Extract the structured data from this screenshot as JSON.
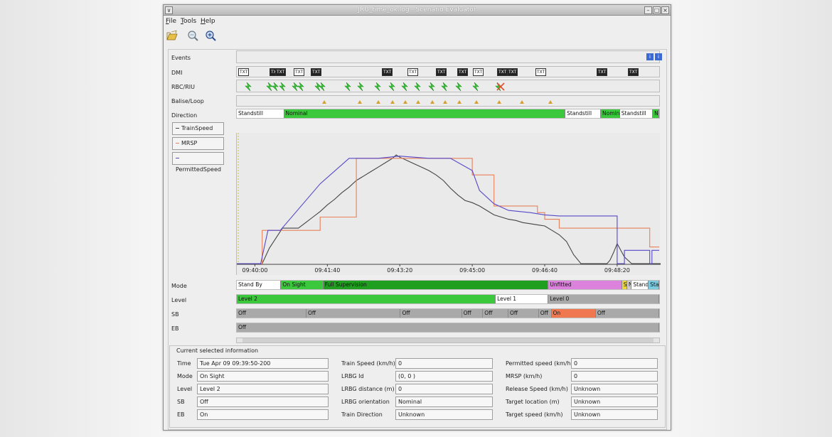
{
  "window": {
    "title": "JRU_time_ok.log - Scenario Evaluator",
    "controls": [
      "∨",
      "–",
      "□",
      "×"
    ]
  },
  "menu": [
    {
      "underline": "F",
      "rest": "ile"
    },
    {
      "underline": "T",
      "rest": "ools"
    },
    {
      "underline": "H",
      "rest": "elp"
    }
  ],
  "toolbar": {
    "icons": [
      "open-folder-icon",
      "zoom-out-icon",
      "zoom-in-icon"
    ]
  },
  "rows": {
    "events": "Events",
    "dmi": "DMI",
    "rbc": "RBC/RIU",
    "balise": "Balise/Loop",
    "direction": "Direction",
    "mode": "Mode",
    "level": "Level",
    "sb": "SB",
    "eb": "EB"
  },
  "legend": [
    {
      "label": "TrainSpeed",
      "color": "#444444"
    },
    {
      "label": "MRSP",
      "color": "#e8805a"
    },
    {
      "label": "PermittedSpeed",
      "color": "#5548c8"
    }
  ],
  "info_icons": [
    "i",
    "i"
  ],
  "dmi_labels": [
    "TXT",
    "TXT",
    "TXT",
    "TXT",
    "TXT",
    "TXT",
    "TXT",
    "TXT",
    "TXT",
    "TXT",
    "TXT",
    "TXT",
    "TXT",
    "TXT",
    "TXT"
  ],
  "direction": [
    {
      "label": "Standstill",
      "start": 0,
      "end": 0.112,
      "color": "#ffffff"
    },
    {
      "label": "Nominal",
      "start": 0.112,
      "end": 0.778,
      "color": "#3cc83c"
    },
    {
      "label": "Standstill",
      "start": 0.778,
      "end": 0.862,
      "color": "#ffffff"
    },
    {
      "label": "Nomin",
      "start": 0.862,
      "end": 0.907,
      "color": "#3cc83c"
    },
    {
      "label": "Standstill",
      "start": 0.907,
      "end": 0.985,
      "color": "#ffffff"
    },
    {
      "label": "N",
      "start": 0.985,
      "end": 1.0,
      "color": "#3cc83c"
    }
  ],
  "mode": [
    {
      "label": "Stand By",
      "start": 0,
      "end": 0.105,
      "color": "#ffffff"
    },
    {
      "label": "On Sight",
      "start": 0.105,
      "end": 0.205,
      "color": "#3cc83c"
    },
    {
      "label": "Full Supervision",
      "start": 0.205,
      "end": 0.738,
      "color": "#1f9e1f"
    },
    {
      "label": "Unfitted",
      "start": 0.738,
      "end": 0.912,
      "color": "#dc82dc"
    },
    {
      "label": "S",
      "start": 0.912,
      "end": 0.924,
      "color": "#ecd640"
    },
    {
      "label": "N",
      "start": 0.924,
      "end": 0.935,
      "color": "#cccccc"
    },
    {
      "label": "Stand",
      "start": 0.935,
      "end": 0.975,
      "color": "#ffffff"
    },
    {
      "label": "Sta",
      "start": 0.975,
      "end": 1.0,
      "color": "#7ccbe0"
    }
  ],
  "level": [
    {
      "label": "Level 2",
      "start": 0,
      "end": 0.613,
      "color": "#3cc83c"
    },
    {
      "label": "Level 1",
      "start": 0.613,
      "end": 0.738,
      "color": "#ffffff"
    },
    {
      "label": "Level 0",
      "start": 0.738,
      "end": 1.0,
      "color": "#a9a9a9"
    }
  ],
  "sb": [
    {
      "label": "Off",
      "start": 0,
      "end": 0.165,
      "color": "#a9a9a9"
    },
    {
      "label": "Off",
      "start": 0.165,
      "end": 0.388,
      "color": "#a9a9a9"
    },
    {
      "label": "Off",
      "start": 0.388,
      "end": 0.533,
      "color": "#a9a9a9"
    },
    {
      "label": "Off",
      "start": 0.533,
      "end": 0.583,
      "color": "#a9a9a9"
    },
    {
      "label": "Off",
      "start": 0.583,
      "end": 0.643,
      "color": "#a9a9a9"
    },
    {
      "label": "Off",
      "start": 0.643,
      "end": 0.715,
      "color": "#a9a9a9"
    },
    {
      "label": "Off",
      "start": 0.715,
      "end": 0.745,
      "color": "#a9a9a9"
    },
    {
      "label": "On",
      "start": 0.745,
      "end": 0.85,
      "color": "#f07850"
    },
    {
      "label": "Off",
      "start": 0.85,
      "end": 1.0,
      "color": "#a9a9a9"
    }
  ],
  "eb": [
    {
      "label": "Off",
      "start": 0,
      "end": 1.0,
      "color": "#a9a9a9"
    }
  ],
  "chart_data": {
    "type": "line",
    "title": "",
    "xlabel": "",
    "ylabel": "",
    "x_ticks": [
      "09:40:00",
      "09:41:40",
      "09:43:20",
      "09:45:00",
      "09:46:40",
      "09:48:20"
    ],
    "x_tick_seconds": [
      0,
      100,
      200,
      300,
      400,
      500
    ],
    "xlim": [
      -25,
      560
    ],
    "ylim": [
      0,
      100
    ],
    "grid": false,
    "legend": "left",
    "series": [
      {
        "name": "TrainSpeed",
        "color": "#444444",
        "x": [
          -25,
          10,
          20,
          38,
          50,
          60,
          70,
          80,
          90,
          100,
          110,
          120,
          130,
          140,
          150,
          160,
          170,
          180,
          190,
          195,
          200,
          210,
          220,
          230,
          240,
          250,
          260,
          270,
          280,
          290,
          300,
          310,
          320,
          330,
          340,
          350,
          360,
          370,
          380,
          390,
          400,
          410,
          420,
          430,
          440,
          450,
          460,
          470,
          480,
          486,
          490,
          495,
          500,
          510,
          520,
          530,
          540,
          550,
          560
        ],
        "y": [
          0,
          0,
          14,
          32,
          32,
          32,
          37,
          42,
          47,
          53,
          58,
          64,
          69,
          75,
          79,
          83,
          87,
          91,
          95,
          98,
          96,
          93,
          90,
          87,
          84,
          80,
          75,
          68,
          62,
          57,
          55,
          52,
          48,
          44,
          42,
          40,
          39,
          37,
          36,
          35,
          34,
          30,
          26,
          20,
          8,
          0,
          0,
          0,
          0,
          0,
          3,
          10,
          18,
          6,
          0,
          0,
          0,
          0,
          0
        ]
      },
      {
        "name": "MRSP",
        "color": "#e8805a",
        "x": [
          -25,
          10,
          10,
          90,
          90,
          140,
          140,
          300,
          300,
          330,
          330,
          390,
          390,
          400,
          400,
          420,
          420,
          545,
          545,
          558
        ],
        "y": [
          0,
          0,
          30,
          30,
          42,
          42,
          95,
          95,
          80,
          80,
          52,
          52,
          46,
          46,
          40,
          40,
          32,
          32,
          15,
          15
        ]
      },
      {
        "name": "PermittedSpeed",
        "color": "#5548c8",
        "x": [
          -25,
          8,
          18,
          35,
          90,
          130,
          170,
          200,
          240,
          270,
          300,
          310,
          330,
          350,
          380,
          400,
          420,
          500,
          500,
          510,
          510,
          545,
          545,
          548,
          548,
          558
        ],
        "y": [
          0,
          0,
          30,
          30,
          72,
          95,
          95,
          97,
          95,
          95,
          84,
          66,
          54,
          48,
          46,
          44,
          43,
          43,
          0,
          0,
          12,
          12,
          0,
          0,
          12,
          12
        ]
      }
    ]
  },
  "info": {
    "title": "Current selected information",
    "fields": [
      {
        "label": "Time",
        "value": "Tue Apr 09 09:39:50-200"
      },
      {
        "label": "Mode",
        "value": "On Sight"
      },
      {
        "label": "Level",
        "value": "Level 2"
      },
      {
        "label": "SB",
        "value": "Off"
      },
      {
        "label": "EB",
        "value": "On"
      },
      {
        "label": "Train Speed (km/h)",
        "value": "0"
      },
      {
        "label": "LRBG Id",
        "value": "(0, 0 )"
      },
      {
        "label": "LRBG distance (m)",
        "value": "0"
      },
      {
        "label": "LRBG orientation",
        "value": "Nominal"
      },
      {
        "label": "Train Direction",
        "value": "Unknown"
      },
      {
        "label": "Permitted speed (km/h)",
        "value": "0"
      },
      {
        "label": "MRSP (km/h)",
        "value": "0"
      },
      {
        "label": "Release Speed (km/h)",
        "value": "Unknown"
      },
      {
        "label": "Target location (m)",
        "value": "Unknown"
      },
      {
        "label": "Target speed (km/h)",
        "value": "Unknown"
      }
    ]
  }
}
